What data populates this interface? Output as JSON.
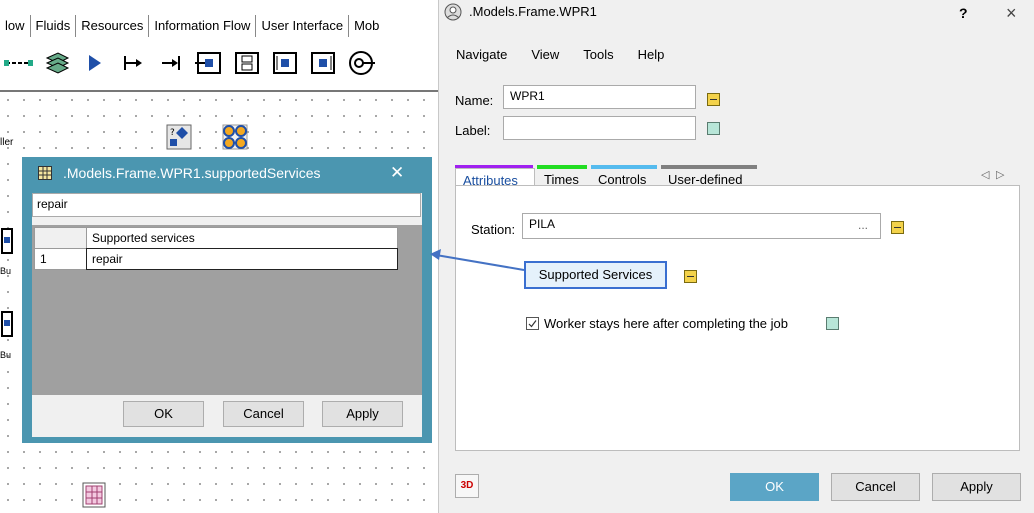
{
  "background": {
    "tabs": [
      "low",
      "Fluids",
      "Resources",
      "Information Flow",
      "User Interface",
      "Mob"
    ],
    "labels": [
      "ller",
      "Bu",
      "Bu"
    ]
  },
  "popup": {
    "title": ".Models.Frame.WPR1.supportedServices",
    "search_value": "repair",
    "grid": {
      "header": "Supported services",
      "rows": [
        {
          "index": "1",
          "value": "repair"
        }
      ]
    },
    "buttons": {
      "ok": "OK",
      "cancel": "Cancel",
      "apply": "Apply"
    }
  },
  "dialog": {
    "title": ".Models.Frame.WPR1",
    "help_btn": "?",
    "close_btn": "×",
    "menu": [
      "Navigate",
      "View",
      "Tools",
      "Help"
    ],
    "name_label": "Name:",
    "name_value": "WPR1",
    "label_label": "Label:",
    "label_value": "",
    "tabs": [
      "Attributes",
      "Times",
      "Controls",
      "User-defined"
    ],
    "tab_colors": [
      "#a020f0",
      "#22dd22",
      "#55bbee",
      "#808080"
    ],
    "station_label": "Station:",
    "station_value": "PILA",
    "station_browse": "...",
    "supported_services_btn": "Supported Services",
    "worker_checkbox": "Worker stays here after completing the job",
    "btn_3d": "3D",
    "ok": "OK",
    "cancel": "Cancel",
    "apply": "Apply"
  }
}
